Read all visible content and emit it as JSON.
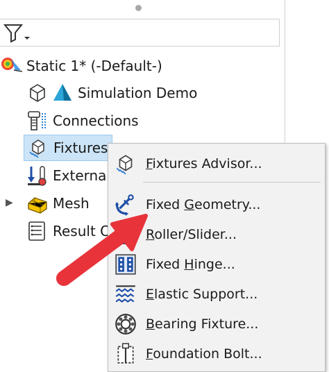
{
  "tree": {
    "study_label": "Static 1* (-Default-)",
    "items": [
      {
        "label": "Simulation Demo"
      },
      {
        "label": "Connections"
      },
      {
        "label": "Fixtures"
      },
      {
        "label": "External"
      },
      {
        "label": "Mesh"
      },
      {
        "label": "Result O"
      }
    ],
    "mesh_expander": "▶"
  },
  "context_menu": {
    "items": [
      {
        "mnemonic": "F",
        "rest": "ixtures Advisor..."
      },
      {
        "pre": "Fixed ",
        "mnemonic": "G",
        "rest": "eometry..."
      },
      {
        "mnemonic": "R",
        "rest": "oller/Slider..."
      },
      {
        "pre": "Fixed ",
        "mnemonic": "H",
        "rest": "inge..."
      },
      {
        "mnemonic": "E",
        "rest": "lastic Support..."
      },
      {
        "mnemonic": "B",
        "rest": "earing Fixture..."
      },
      {
        "mnemonic": "F",
        "rest": "oundation Bolt..."
      }
    ]
  },
  "colors": {
    "selection": "#cce4f7",
    "arrow": "#e8333b",
    "menu_bg": "#f2f2f2"
  }
}
